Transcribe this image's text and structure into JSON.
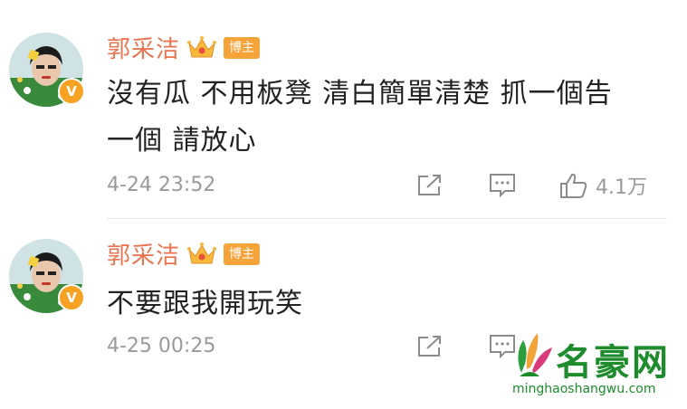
{
  "posts": [
    {
      "username": "郭采洁",
      "tag": "博主",
      "content_line1": "沒有瓜 不用板凳 清白簡單清楚 抓一個告",
      "content_line2": "一個 請放心",
      "timestamp": "4-24 23:52",
      "like_count": "4.1万"
    },
    {
      "username": "郭采洁",
      "tag": "博主",
      "content_line1": "不要跟我開玩笑",
      "timestamp": "4-25 00:25"
    }
  ],
  "verified_badge": "V",
  "icons": [
    "crown-icon",
    "share-icon",
    "comment-icon",
    "like-icon",
    "verified-icon"
  ],
  "colors": {
    "username": "#eb7350",
    "tag_bg": "#f6a43a",
    "verified": "#f7a223",
    "meta": "#9a9a9a",
    "watermark": "#1e8c2d"
  },
  "watermark": {
    "title": "名豪网",
    "url": "minghaoshangwu.com"
  }
}
